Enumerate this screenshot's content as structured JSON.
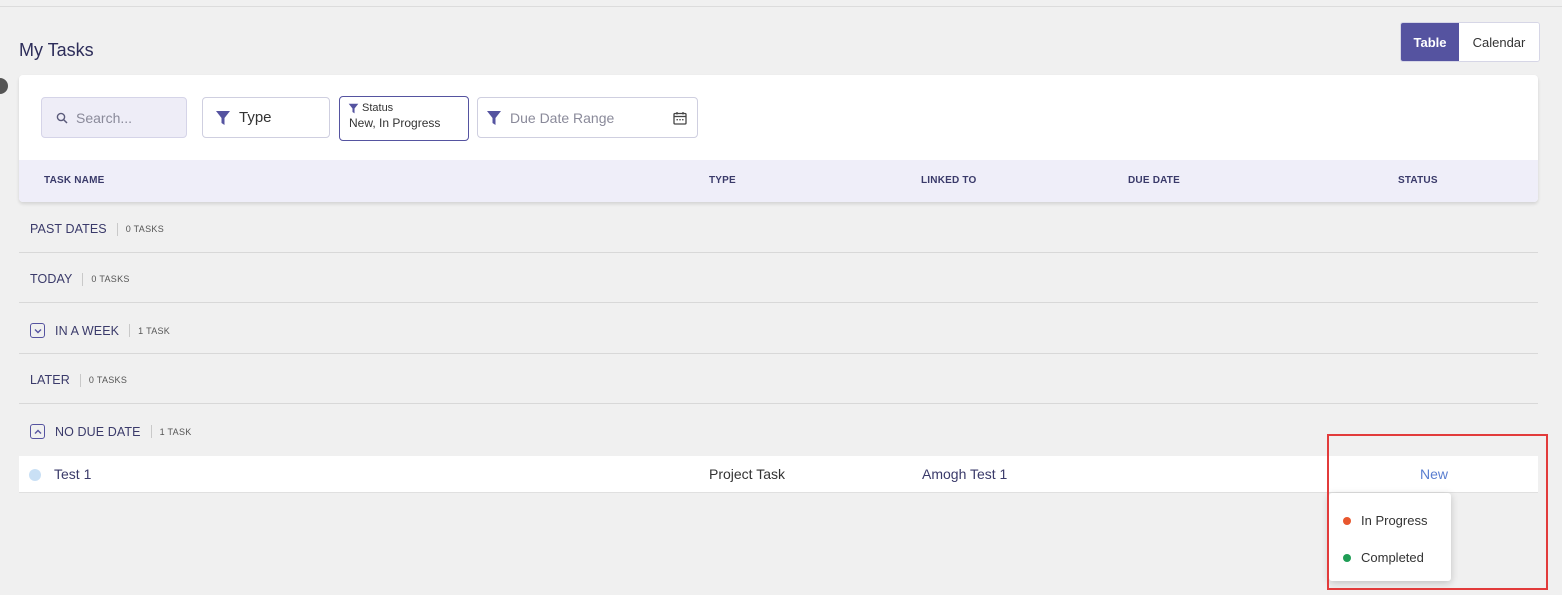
{
  "page": {
    "title": "My Tasks"
  },
  "view_toggle": {
    "table_label": "Table",
    "calendar_label": "Calendar",
    "active": "Table"
  },
  "filters": {
    "search_placeholder": "Search...",
    "type_label": "Type",
    "status_label": "Status",
    "status_value": "New, In Progress",
    "date_placeholder": "Due Date Range"
  },
  "columns": {
    "task_name": "TASK NAME",
    "type": "TYPE",
    "linked_to": "LINKED TO",
    "due_date": "DUE DATE",
    "status": "STATUS"
  },
  "groups": [
    {
      "name": "PAST DATES",
      "count": "0 TASKS",
      "collapsible": false
    },
    {
      "name": "TODAY",
      "count": "0 TASKS",
      "collapsible": false
    },
    {
      "name": "IN A WEEK",
      "count": "1 TASK",
      "collapsible": true,
      "expanded": false
    },
    {
      "name": "LATER",
      "count": "0 TASKS",
      "collapsible": false
    },
    {
      "name": "NO DUE DATE",
      "count": "1 TASK",
      "collapsible": true,
      "expanded": true
    }
  ],
  "tasks": [
    {
      "name": "Test 1",
      "type": "Project Task",
      "linked_to": "Amogh Test 1",
      "due_date": "",
      "status": "New"
    }
  ],
  "status_dropdown": {
    "options": [
      {
        "label": "In Progress",
        "color": "#e8572e"
      },
      {
        "label": "Completed",
        "color": "#1f9d55"
      }
    ]
  },
  "colors": {
    "accent": "#5553a0",
    "task_dot": "#c9e0f5",
    "highlight": "#e23b3b"
  }
}
